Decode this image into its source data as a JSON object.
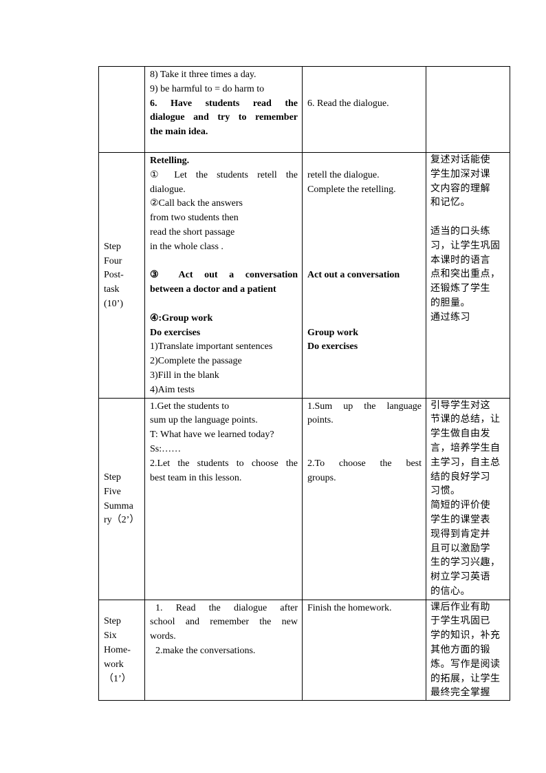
{
  "table": {
    "rows": [
      {
        "step": [],
        "activities": [
          {
            "text": "8) Take it three times a day.",
            "bold": false,
            "justify": false
          },
          {
            "text": "9) be harmful to = do harm to",
            "bold": false,
            "justify": false
          },
          {
            "text": "6.  Have  students  read  the",
            "bold": true,
            "justify": true
          },
          {
            "text": "dialogue and try to remember",
            "bold": true,
            "justify": true
          },
          {
            "text": "the main idea.",
            "bold": true,
            "justify": false
          }
        ],
        "student": [
          {
            "text": "",
            "bold": false
          },
          {
            "text": "",
            "bold": false
          },
          {
            "text": "6. Read the dialogue.",
            "bold": false
          }
        ],
        "purpose": []
      },
      {
        "step": [
          "Step",
          "Four",
          "Post-",
          "task",
          "(10’)"
        ],
        "activities": [
          {
            "text": "Retelling.",
            "bold": true,
            "justify": false
          },
          {
            "text": "① Let  the  students  retell  the",
            "bold": false,
            "justify": true
          },
          {
            "text": "dialogue.",
            "bold": false,
            "justify": false
          },
          {
            "text": "②Call back the answers",
            "bold": false,
            "justify": false
          },
          {
            "text": "from two students then",
            "bold": false,
            "justify": false
          },
          {
            "text": "read the short passage",
            "bold": false,
            "justify": false
          },
          {
            "text": "in the whole class .",
            "bold": false,
            "justify": false
          },
          {
            "text": "",
            "bold": false,
            "justify": false
          },
          {
            "text": "③  Act  out  a  conversation",
            "bold": true,
            "justify": true
          },
          {
            "text": "between a doctor and a patient",
            "bold": true,
            "justify": false
          },
          {
            "text": "",
            "bold": false,
            "justify": false
          },
          {
            "text": "④:Group work",
            "bold": true,
            "justify": false
          },
          {
            "text": "Do exercises",
            "bold": true,
            "justify": false
          },
          {
            "text": "1)Translate important sentences",
            "bold": false,
            "justify": false
          },
          {
            "text": "2)Complete the passage",
            "bold": false,
            "justify": false
          },
          {
            "text": "3)Fill in the blank",
            "bold": false,
            "justify": false
          },
          {
            "text": "4)Aim tests",
            "bold": false,
            "justify": false
          }
        ],
        "student": [
          {
            "text": "",
            "bold": false
          },
          {
            "text": "retell the dialogue.",
            "bold": false
          },
          {
            "text": "Complete the retelling.",
            "bold": false
          },
          {
            "text": "",
            "bold": false
          },
          {
            "text": "",
            "bold": false
          },
          {
            "text": "",
            "bold": false
          },
          {
            "text": "",
            "bold": false
          },
          {
            "text": "",
            "bold": false
          },
          {
            "text": "Act out a conversation",
            "bold": true
          },
          {
            "text": "",
            "bold": false
          },
          {
            "text": "",
            "bold": false
          },
          {
            "text": "",
            "bold": false
          },
          {
            "text": "Group work",
            "bold": true
          },
          {
            "text": "Do exercises",
            "bold": true
          }
        ],
        "purpose": [
          "复述对话能使",
          "学生加深对课",
          "文内容的理解",
          "和记忆。",
          "",
          "适当的口头练",
          "习，让学生巩固",
          "本课时的语言",
          "点和突出重点，",
          "还锻炼了学生",
          "的胆量。",
          "通过练习"
        ]
      },
      {
        "step": [
          "Step",
          "Five",
          "Summa",
          "ry（2’）"
        ],
        "activities": [
          {
            "text": "1.Get the students to",
            "bold": false,
            "justify": false
          },
          {
            "text": "sum up the language points.",
            "bold": false,
            "justify": false
          },
          {
            "text": "T: What have we learned today?",
            "bold": false,
            "justify": false
          },
          {
            "text": "Ss:……",
            "bold": false,
            "justify": false
          },
          {
            "text": "2.Let the students to choose the",
            "bold": false,
            "justify": true
          },
          {
            "text": "best team in this lesson.",
            "bold": false,
            "justify": false
          }
        ],
        "student": [
          {
            "text": "1.Sum  up  the  language",
            "bold": false,
            "justify": true
          },
          {
            "text": "points.",
            "bold": false
          },
          {
            "text": "",
            "bold": false
          },
          {
            "text": "",
            "bold": false
          },
          {
            "text": "2.To  choose  the  best",
            "bold": false,
            "justify": true
          },
          {
            "text": "groups.",
            "bold": false
          }
        ],
        "purpose": [
          "引导学生对这",
          "节课的总结，让",
          "学生做自由发",
          "言，培养学生自",
          "主学习，自主总",
          "结的良好学习",
          "习惯。",
          "简短的评价使",
          "学生的课堂表",
          "现得到肯定并",
          "且可以激励学",
          "生的学习兴趣，",
          "树立学习英语",
          "的信心。"
        ]
      },
      {
        "step": [
          "Step",
          "Six",
          "Home-",
          "work",
          "（1’）"
        ],
        "activities": [
          {
            "text": "  1.  Read  the  dialogue  after",
            "bold": false,
            "justify": true,
            "indent": true
          },
          {
            "text": "school  and  remember  the  new",
            "bold": false,
            "justify": true
          },
          {
            "text": "words.",
            "bold": false,
            "justify": false
          },
          {
            "text": "  2.make the conversations.",
            "bold": false,
            "justify": false,
            "indent": true
          }
        ],
        "student": [
          {
            "text": "Finish the homework.",
            "bold": false
          }
        ],
        "purpose": [
          "课后作业有助",
          "于学生巩固已",
          "学的知识，补充",
          "其他方面的锻",
          "炼。写作是阅读",
          "的拓展，让学生",
          "最终完全掌握"
        ]
      }
    ]
  }
}
